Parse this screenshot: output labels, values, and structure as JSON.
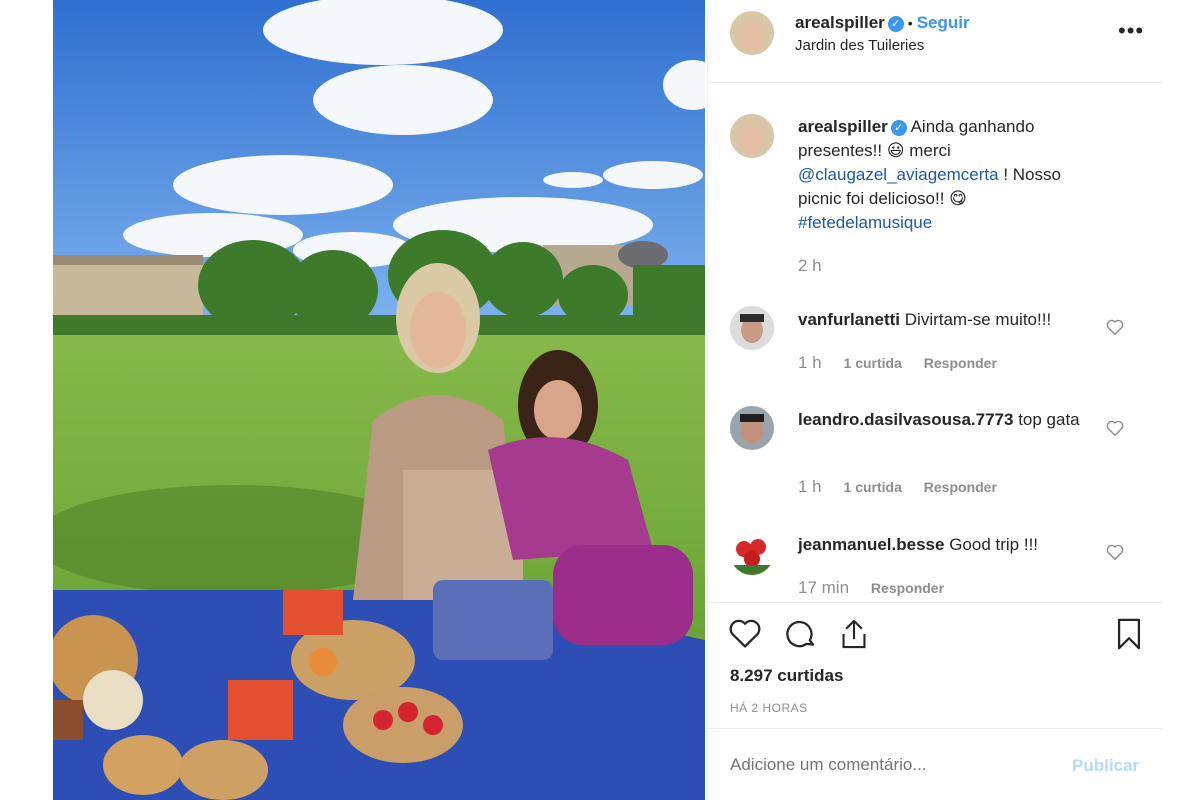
{
  "post": {
    "username": "arealspiller",
    "follow_label": "Seguir",
    "location": "Jardin des Tuileries",
    "more_label": "•••"
  },
  "caption": {
    "username": "arealspiller",
    "text_1": "Ainda ganhando presentes!! 😃 merci",
    "mention": "@claugazel_aviagemcerta",
    "text_2": "! Nosso picnic foi delicioso!! 😋",
    "hashtag": "#fetedelamusique",
    "time": "2 h"
  },
  "comments": [
    {
      "username": "vanfurlanetti",
      "text": "Divirtam-se muito!!!",
      "time": "1 h",
      "likes": "1 curtida",
      "reply": "Responder"
    },
    {
      "username": "leandro.dasilvasousa.7773",
      "text": "top gata",
      "time": "1 h",
      "likes": "1 curtida",
      "reply": "Responder"
    },
    {
      "username": "jeanmanuel.besse",
      "text": "Good trip !!!",
      "time": "17 min",
      "likes": "",
      "reply": "Responder"
    }
  ],
  "stats": {
    "likes": "8.297 curtidas",
    "posted": "HÁ 2 HORAS"
  },
  "compose": {
    "placeholder": "Adicione um comentário...",
    "publish_label": "Publicar"
  },
  "colors": {
    "accent": "#3897f0",
    "publish_disabled": "#b3dbff"
  }
}
